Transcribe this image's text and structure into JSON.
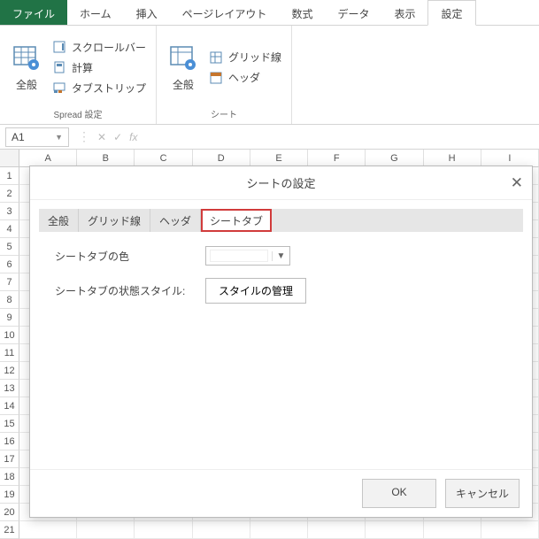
{
  "ribbon": {
    "tabs": [
      "ファイル",
      "ホーム",
      "挿入",
      "ページレイアウト",
      "数式",
      "データ",
      "表示",
      "設定"
    ],
    "group1": {
      "big": "全般",
      "items": [
        "スクロールバー",
        "計算",
        "タブストリップ"
      ],
      "label": "Spread 設定"
    },
    "group2": {
      "big": "全般",
      "items": [
        "グリッド線",
        "ヘッダ"
      ],
      "label": "シート"
    }
  },
  "formulaBar": {
    "cellRef": "A1",
    "fx": "fx"
  },
  "grid": {
    "cols": [
      "A",
      "B",
      "C",
      "D",
      "E",
      "F",
      "G",
      "H",
      "I"
    ],
    "rows": [
      "1",
      "2",
      "3",
      "4",
      "5",
      "6",
      "7",
      "8",
      "9",
      "10",
      "11",
      "12",
      "13",
      "14",
      "15",
      "16",
      "17",
      "18",
      "19",
      "20",
      "21"
    ]
  },
  "dialog": {
    "title": "シートの設定",
    "tabs": [
      "全般",
      "グリッド線",
      "ヘッダ",
      "シートタブ"
    ],
    "row1Label": "シートタブの色",
    "row2Label": "シートタブの状態スタイル:",
    "row2Button": "スタイルの管理",
    "ok": "OK",
    "cancel": "キャンセル"
  }
}
